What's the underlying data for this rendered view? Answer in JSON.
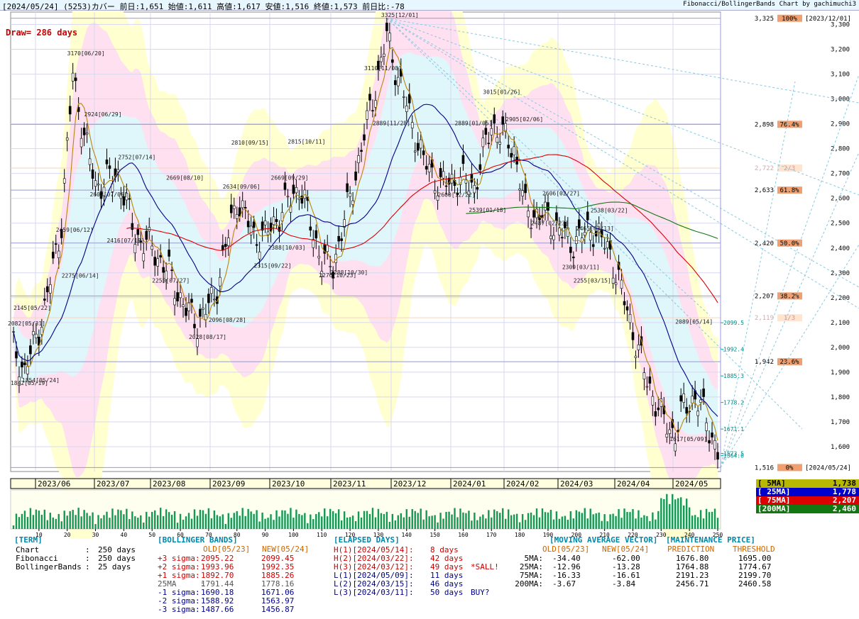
{
  "header": {
    "left": "[2024/05/24]  (5253)カバー    前日:1,651    始値:1,611   高値:1,617   安値:1,516   終値:1,573    前日比:-78",
    "right": "Fibonacci/BollingerBands Chart by gachimuchi3"
  },
  "draw_label": "Draw= 286 days",
  "colors": {
    "candle": "#000000",
    "ma5": "#b8860b",
    "ma25": "#000088",
    "ma75": "#dd0000",
    "ma200": "#117711",
    "grid": "#d8d8f0",
    "fib": "#9999cc"
  },
  "chart_data": {
    "type": "candlestick",
    "x_axis": {
      "months": [
        "2023/06",
        "2023/07",
        "2023/08",
        "2023/09",
        "2023/10",
        "2023/11",
        "2023/12",
        "2024/01",
        "2024/02",
        "2024/03",
        "2024/04",
        "2024/05"
      ],
      "day_ticks": [
        "10",
        "20",
        "30",
        "40",
        "50",
        "60",
        "70",
        "80",
        "90",
        "100",
        "110",
        "120",
        "130",
        "140",
        "150",
        "160",
        "170",
        "180",
        "190",
        "200",
        "210",
        "220",
        "230",
        "240",
        "250"
      ]
    },
    "y_axis": {
      "ylim": [
        1500,
        3350
      ],
      "ticks": [
        "1,600",
        "1,700",
        "1,800",
        "1,900",
        "2,000",
        "2,100",
        "2,200",
        "2,300",
        "2,400",
        "2,500",
        "2,600",
        "2,700",
        "2,800",
        "2,900",
        "3,000",
        "3,100",
        "3,200",
        "3,300"
      ]
    },
    "fibonacci": [
      {
        "price": 3325,
        "price_label": "3,325",
        "label": "100%",
        "note": "[2023/12/01]"
      },
      {
        "price": 2898,
        "price_label": "2,898",
        "label": "76.4%"
      },
      {
        "price": 2722,
        "price_label": "2,722",
        "label": "2/3"
      },
      {
        "price": 2633,
        "price_label": "2,633",
        "label": "61.8%"
      },
      {
        "price": 2420,
        "price_label": "2,420",
        "label": "50.0%"
      },
      {
        "price": 2207,
        "price_label": "2,207",
        "label": "38.2%"
      },
      {
        "price": 2119,
        "price_label": "2,119",
        "label": "1/3"
      },
      {
        "price": 1942,
        "price_label": "1,942",
        "label": "23.6%"
      },
      {
        "price": 1516,
        "price_label": "1,516",
        "label": "0%",
        "note": "[2024/05/24]"
      }
    ],
    "bollinger_right": [
      {
        "price": 2099,
        "label": "2099.5"
      },
      {
        "price": 1992,
        "label": "1992.4"
      },
      {
        "price": 1885,
        "label": "1885.3"
      },
      {
        "price": 1778,
        "label": "1778.2"
      },
      {
        "price": 1671,
        "label": "1671.1"
      },
      {
        "price": 1573,
        "label": "1573.5"
      },
      {
        "price": 1564,
        "label": "1564.0"
      }
    ],
    "annotations": [
      {
        "day": 1,
        "price": 2082,
        "label": "2082[05/31]"
      },
      {
        "day": 3,
        "price": 2145,
        "label": "2145[05/22]"
      },
      {
        "day": 2,
        "price": 1842,
        "label": "1842[05/19]"
      },
      {
        "day": 6,
        "price": 1854,
        "label": "1854[05/24]"
      },
      {
        "day": 22,
        "price": 3170,
        "label": "3170[06/20]"
      },
      {
        "day": 28,
        "price": 2924,
        "label": "2924[06/29]"
      },
      {
        "day": 18,
        "price": 2459,
        "label": "2459[06/12]"
      },
      {
        "day": 20,
        "price": 2275,
        "label": "2275[06/14]"
      },
      {
        "day": 30,
        "price": 2602,
        "label": "2602[07/06]"
      },
      {
        "day": 40,
        "price": 2752,
        "label": "2752[07/14]"
      },
      {
        "day": 36,
        "price": 2416,
        "label": "2416[07/18]"
      },
      {
        "day": 52,
        "price": 2255,
        "label": "2255[07/27]"
      },
      {
        "day": 57,
        "price": 2669,
        "label": "2669[08/10]"
      },
      {
        "day": 65,
        "price": 2028,
        "label": "2028[08/17]"
      },
      {
        "day": 72,
        "price": 2096,
        "label": "2096[08/28]"
      },
      {
        "day": 80,
        "price": 2810,
        "label": "2810[09/15]"
      },
      {
        "day": 77,
        "price": 2634,
        "label": "2634[09/06]"
      },
      {
        "day": 88,
        "price": 2315,
        "label": "2315[09/22]"
      },
      {
        "day": 94,
        "price": 2669,
        "label": "2669[09/29]"
      },
      {
        "day": 100,
        "price": 2815,
        "label": "2815[10/11]"
      },
      {
        "day": 93,
        "price": 2388,
        "label": "2388[10/03]"
      },
      {
        "day": 111,
        "price": 2276,
        "label": "2276[10/23]"
      },
      {
        "day": 115,
        "price": 2288,
        "label": "2288[10/30]"
      },
      {
        "day": 133,
        "price": 3325,
        "label": "3325[12/01]"
      },
      {
        "day": 127,
        "price": 3110,
        "label": "3110[11/08]"
      },
      {
        "day": 130,
        "price": 2889,
        "label": "2889[11/28]"
      },
      {
        "day": 159,
        "price": 2889,
        "label": "2889[01/05]"
      },
      {
        "day": 153,
        "price": 2600,
        "label": "2600[12/22]"
      },
      {
        "day": 169,
        "price": 3015,
        "label": "3015[01/26]"
      },
      {
        "day": 177,
        "price": 2905,
        "label": "2905[02/06]"
      },
      {
        "day": 164,
        "price": 2539,
        "label": "2539[01/18]"
      },
      {
        "day": 190,
        "price": 2606,
        "label": "2606[02/27]"
      },
      {
        "day": 186,
        "price": 2487,
        "label": "2487[02/23]"
      },
      {
        "day": 207,
        "price": 2538,
        "label": "2538[03/22]"
      },
      {
        "day": 202,
        "price": 2465,
        "label": "2465[03/13]"
      },
      {
        "day": 197,
        "price": 2309,
        "label": "2309[03/11]"
      },
      {
        "day": 201,
        "price": 2255,
        "label": "2255[03/15]"
      },
      {
        "day": 237,
        "price": 2089,
        "label": "2089[05/14]"
      },
      {
        "day": 235,
        "price": 1617,
        "label": "1617[05/09]"
      }
    ]
  },
  "ma_legend": [
    {
      "name": "[ 5MA]",
      "value": "1,738",
      "bg": "#b8b800",
      "fg": "#000"
    },
    {
      "name": "[ 25MA]",
      "value": "1,778",
      "bg": "#0000cc",
      "fg": "#fff"
    },
    {
      "name": "[ 75MA]",
      "value": "2,207",
      "bg": "#dd0000",
      "fg": "#fff"
    },
    {
      "name": "[200MA]",
      "value": "2,460",
      "bg": "#117711",
      "fg": "#fff"
    }
  ],
  "term": {
    "title": "[TERM]",
    "rows": [
      {
        "k": "Chart",
        "v": "250 days"
      },
      {
        "k": "Fibonacci",
        "v": "250 days"
      },
      {
        "k": "BollingerBands",
        "v": "25 days"
      }
    ]
  },
  "bollinger": {
    "title": "[BOLLINGER BANDS]",
    "col_old": "OLD[05/23]",
    "col_new": "NEW[05/24]",
    "rows": [
      {
        "k": "+3 sigma:",
        "old": "2095.22",
        "new": "2099.45"
      },
      {
        "k": "+2 sigma:",
        "old": "1993.96",
        "new": "1992.35"
      },
      {
        "k": "+1 sigma:",
        "old": "1892.70",
        "new": "1885.26"
      },
      {
        "k": "25MA     :",
        "old": "1791.44",
        "new": "1778.16"
      },
      {
        "k": "-1 sigma:",
        "old": "1690.18",
        "new": "1671.06"
      },
      {
        "k": "-2 sigma:",
        "old": "1588.92",
        "new": "1563.97"
      },
      {
        "k": "-3 sigma:",
        "old": "1487.66",
        "new": "1456.87"
      }
    ]
  },
  "elapsed": {
    "title": "[ELAPSED DAYS]",
    "rows": [
      {
        "k": "H(1)[2024/05/14]:",
        "v": "8 days",
        "x": ""
      },
      {
        "k": "H(2)[2024/03/22]:",
        "v": "42 days",
        "x": ""
      },
      {
        "k": "H(3)[2024/03/12]:",
        "v": "49 days",
        "x": "*SALL!"
      },
      {
        "k": "L(1)[2024/05/09]:",
        "v": "11 days",
        "x": ""
      },
      {
        "k": "L(2)[2024/03/15]:",
        "v": "46 days",
        "x": ""
      },
      {
        "k": "L(3)[2024/03/11]:",
        "v": "50 days",
        "x": "BUY?"
      }
    ]
  },
  "mav": {
    "title": "[MOVING AVERAGE VECTOR]",
    "col_old": "OLD[05/23]",
    "col_new": "NEW[05/24]",
    "rows": [
      {
        "k": "5MA:",
        "old": "-34.40",
        "new": "-62.00"
      },
      {
        "k": "25MA:",
        "old": "-12.96",
        "new": "-13.28"
      },
      {
        "k": "75MA:",
        "old": "-16.33",
        "new": "-16.61"
      },
      {
        "k": "200MA:",
        "old": "-3.67",
        "new": "-3.84"
      }
    ]
  },
  "maint": {
    "title": "[MAINTENANCE PRICE]",
    "col_pred": "PREDICTION",
    "col_thr": "THRESHOLD",
    "rows": [
      {
        "pred": "1676.80",
        "thr": "1695.00"
      },
      {
        "pred": "1764.88",
        "thr": "1774.67"
      },
      {
        "pred": "2191.23",
        "thr": "2199.70"
      },
      {
        "pred": "2456.71",
        "thr": "2460.58"
      }
    ]
  }
}
